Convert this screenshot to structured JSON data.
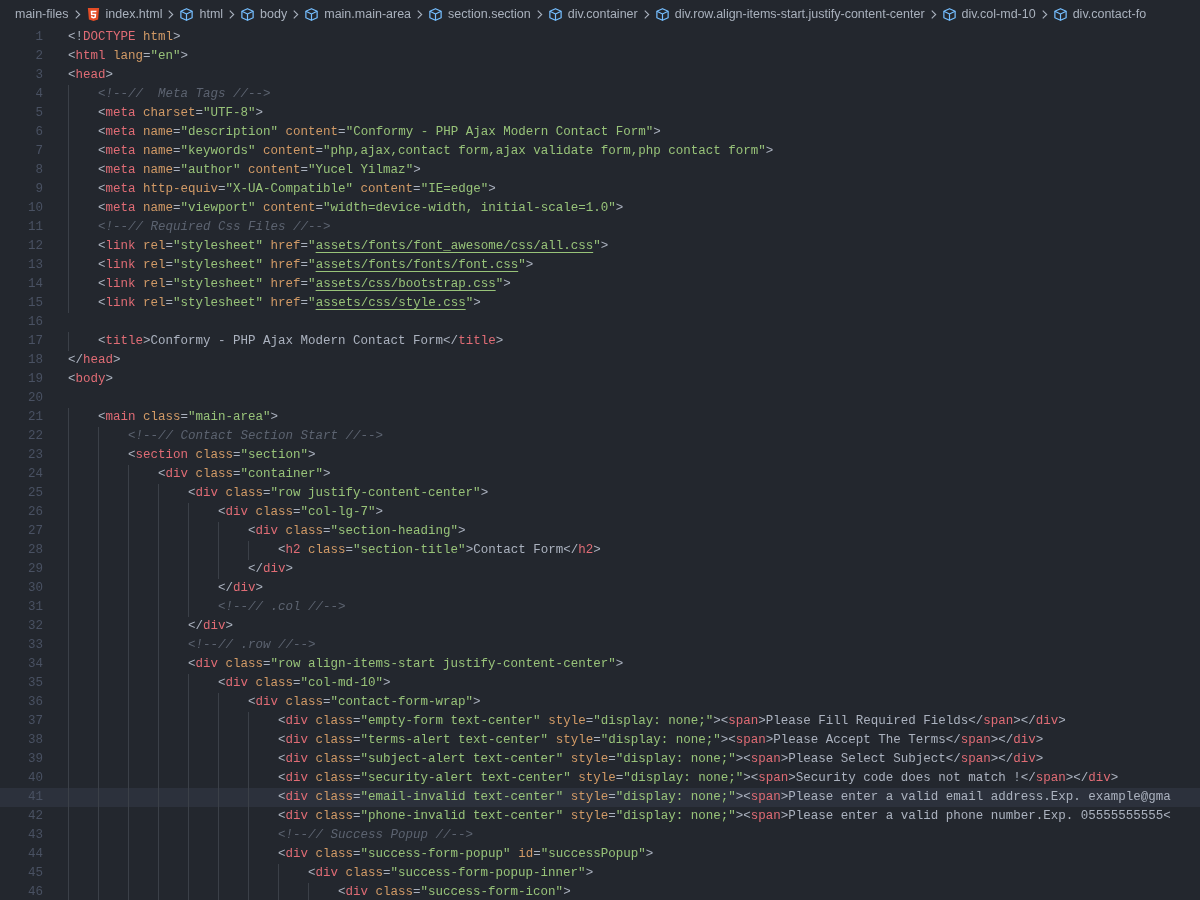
{
  "breadcrumbs": [
    {
      "kind": "folder",
      "label": "main-files"
    },
    {
      "kind": "html-file",
      "label": "index.html"
    },
    {
      "kind": "element",
      "label": "html"
    },
    {
      "kind": "element",
      "label": "body"
    },
    {
      "kind": "element",
      "label": "main.main-area"
    },
    {
      "kind": "element",
      "label": "section.section"
    },
    {
      "kind": "element",
      "label": "div.container"
    },
    {
      "kind": "element",
      "label": "div.row.align-items-start.justify-content-center"
    },
    {
      "kind": "element",
      "label": "div.col-md-10"
    },
    {
      "kind": "element",
      "label": "div.contact-fo"
    }
  ],
  "lines": [
    {
      "number": "1",
      "current": false,
      "tokens": [
        {
          "kind": "p",
          "text": "<!"
        },
        {
          "kind": "t",
          "text": "DOCTYPE"
        },
        {
          "kind": "a",
          "text": " html"
        },
        {
          "kind": "p",
          "text": ">"
        }
      ]
    },
    {
      "number": "2",
      "current": false,
      "tokens": [
        {
          "kind": "p",
          "text": "<"
        },
        {
          "kind": "t",
          "text": "html"
        },
        {
          "kind": "a",
          "text": " lang"
        },
        {
          "kind": "p",
          "text": "="
        },
        {
          "kind": "s",
          "text": "\"en\""
        },
        {
          "kind": "p",
          "text": ">"
        }
      ]
    },
    {
      "number": "3",
      "current": false,
      "tokens": [
        {
          "kind": "p",
          "text": "<"
        },
        {
          "kind": "t",
          "text": "head"
        },
        {
          "kind": "p",
          "text": ">"
        }
      ]
    },
    {
      "number": "4",
      "current": false,
      "tokens": [
        {
          "kind": "c",
          "text": "    <!--//  Meta Tags //-->"
        }
      ]
    },
    {
      "number": "5",
      "current": false,
      "tokens": [
        {
          "kind": "p",
          "text": "    <"
        },
        {
          "kind": "t",
          "text": "meta"
        },
        {
          "kind": "a",
          "text": " charset"
        },
        {
          "kind": "p",
          "text": "="
        },
        {
          "kind": "s",
          "text": "\"UTF-8\""
        },
        {
          "kind": "p",
          "text": ">"
        }
      ]
    },
    {
      "number": "6",
      "current": false,
      "tokens": [
        {
          "kind": "p",
          "text": "    <"
        },
        {
          "kind": "t",
          "text": "meta"
        },
        {
          "kind": "a",
          "text": " name"
        },
        {
          "kind": "p",
          "text": "="
        },
        {
          "kind": "s",
          "text": "\"description\""
        },
        {
          "kind": "a",
          "text": " content"
        },
        {
          "kind": "p",
          "text": "="
        },
        {
          "kind": "s",
          "text": "\"Conformy - PHP Ajax Modern Contact Form\""
        },
        {
          "kind": "p",
          "text": ">"
        }
      ]
    },
    {
      "number": "7",
      "current": false,
      "tokens": [
        {
          "kind": "p",
          "text": "    <"
        },
        {
          "kind": "t",
          "text": "meta"
        },
        {
          "kind": "a",
          "text": " name"
        },
        {
          "kind": "p",
          "text": "="
        },
        {
          "kind": "s",
          "text": "\"keywords\""
        },
        {
          "kind": "a",
          "text": " content"
        },
        {
          "kind": "p",
          "text": "="
        },
        {
          "kind": "s",
          "text": "\"php,ajax,contact form,ajax validate form,php contact form\""
        },
        {
          "kind": "p",
          "text": ">"
        }
      ]
    },
    {
      "number": "8",
      "current": false,
      "tokens": [
        {
          "kind": "p",
          "text": "    <"
        },
        {
          "kind": "t",
          "text": "meta"
        },
        {
          "kind": "a",
          "text": " name"
        },
        {
          "kind": "p",
          "text": "="
        },
        {
          "kind": "s",
          "text": "\"author\""
        },
        {
          "kind": "a",
          "text": " content"
        },
        {
          "kind": "p",
          "text": "="
        },
        {
          "kind": "s",
          "text": "\"Yucel Yilmaz\""
        },
        {
          "kind": "p",
          "text": ">"
        }
      ]
    },
    {
      "number": "9",
      "current": false,
      "tokens": [
        {
          "kind": "p",
          "text": "    <"
        },
        {
          "kind": "t",
          "text": "meta"
        },
        {
          "kind": "a",
          "text": " http-equiv"
        },
        {
          "kind": "p",
          "text": "="
        },
        {
          "kind": "s",
          "text": "\"X-UA-Compatible\""
        },
        {
          "kind": "a",
          "text": " content"
        },
        {
          "kind": "p",
          "text": "="
        },
        {
          "kind": "s",
          "text": "\"IE=edge\""
        },
        {
          "kind": "p",
          "text": ">"
        }
      ]
    },
    {
      "number": "10",
      "current": false,
      "tokens": [
        {
          "kind": "p",
          "text": "    <"
        },
        {
          "kind": "t",
          "text": "meta"
        },
        {
          "kind": "a",
          "text": " name"
        },
        {
          "kind": "p",
          "text": "="
        },
        {
          "kind": "s",
          "text": "\"viewport\""
        },
        {
          "kind": "a",
          "text": " content"
        },
        {
          "kind": "p",
          "text": "="
        },
        {
          "kind": "s",
          "text": "\"width=device-width, initial-scale=1.0\""
        },
        {
          "kind": "p",
          "text": ">"
        }
      ]
    },
    {
      "number": "11",
      "current": false,
      "tokens": [
        {
          "kind": "c",
          "text": "    <!--// Required Css Files //-->"
        }
      ]
    },
    {
      "number": "12",
      "current": false,
      "tokens": [
        {
          "kind": "p",
          "text": "    <"
        },
        {
          "kind": "t",
          "text": "link"
        },
        {
          "kind": "a",
          "text": " rel"
        },
        {
          "kind": "p",
          "text": "="
        },
        {
          "kind": "s",
          "text": "\"stylesheet\""
        },
        {
          "kind": "a",
          "text": " href"
        },
        {
          "kind": "p",
          "text": "="
        },
        {
          "kind": "s",
          "text": "\""
        },
        {
          "kind": "u",
          "text": "assets/fonts/font_awesome/css/all.css"
        },
        {
          "kind": "s",
          "text": "\""
        },
        {
          "kind": "p",
          "text": ">"
        }
      ]
    },
    {
      "number": "13",
      "current": false,
      "tokens": [
        {
          "kind": "p",
          "text": "    <"
        },
        {
          "kind": "t",
          "text": "link"
        },
        {
          "kind": "a",
          "text": " rel"
        },
        {
          "kind": "p",
          "text": "="
        },
        {
          "kind": "s",
          "text": "\"stylesheet\""
        },
        {
          "kind": "a",
          "text": " href"
        },
        {
          "kind": "p",
          "text": "="
        },
        {
          "kind": "s",
          "text": "\""
        },
        {
          "kind": "u",
          "text": "assets/fonts/fonts/font.css"
        },
        {
          "kind": "s",
          "text": "\""
        },
        {
          "kind": "p",
          "text": ">"
        }
      ]
    },
    {
      "number": "14",
      "current": false,
      "tokens": [
        {
          "kind": "p",
          "text": "    <"
        },
        {
          "kind": "t",
          "text": "link"
        },
        {
          "kind": "a",
          "text": " rel"
        },
        {
          "kind": "p",
          "text": "="
        },
        {
          "kind": "s",
          "text": "\"stylesheet\""
        },
        {
          "kind": "a",
          "text": " href"
        },
        {
          "kind": "p",
          "text": "="
        },
        {
          "kind": "s",
          "text": "\""
        },
        {
          "kind": "u",
          "text": "assets/css/bootstrap.css"
        },
        {
          "kind": "s",
          "text": "\""
        },
        {
          "kind": "p",
          "text": ">"
        }
      ]
    },
    {
      "number": "15",
      "current": false,
      "tokens": [
        {
          "kind": "p",
          "text": "    <"
        },
        {
          "kind": "t",
          "text": "link"
        },
        {
          "kind": "a",
          "text": " rel"
        },
        {
          "kind": "p",
          "text": "="
        },
        {
          "kind": "s",
          "text": "\"stylesheet\""
        },
        {
          "kind": "a",
          "text": " href"
        },
        {
          "kind": "p",
          "text": "="
        },
        {
          "kind": "s",
          "text": "\""
        },
        {
          "kind": "u",
          "text": "assets/css/style.css"
        },
        {
          "kind": "s",
          "text": "\""
        },
        {
          "kind": "p",
          "text": ">"
        }
      ]
    },
    {
      "number": "16",
      "current": false
    },
    {
      "number": "17",
      "current": false,
      "tokens": [
        {
          "kind": "p",
          "text": "    <"
        },
        {
          "kind": "t",
          "text": "title"
        },
        {
          "kind": "p",
          "text": ">"
        },
        {
          "kind": "x",
          "text": "Conformy - PHP Ajax Modern Contact Form"
        },
        {
          "kind": "p",
          "text": "</"
        },
        {
          "kind": "t",
          "text": "title"
        },
        {
          "kind": "p",
          "text": ">"
        }
      ]
    },
    {
      "number": "18",
      "current": false,
      "tokens": [
        {
          "kind": "p",
          "text": "</"
        },
        {
          "kind": "t",
          "text": "head"
        },
        {
          "kind": "p",
          "text": ">"
        }
      ]
    },
    {
      "number": "19",
      "current": false,
      "tokens": [
        {
          "kind": "p",
          "text": "<"
        },
        {
          "kind": "t",
          "text": "body"
        },
        {
          "kind": "p",
          "text": ">"
        }
      ]
    },
    {
      "number": "20",
      "current": false
    },
    {
      "number": "21",
      "current": false,
      "tokens": [
        {
          "kind": "p",
          "text": "    <"
        },
        {
          "kind": "t",
          "text": "main"
        },
        {
          "kind": "a",
          "text": " class"
        },
        {
          "kind": "p",
          "text": "="
        },
        {
          "kind": "s",
          "text": "\"main-area\""
        },
        {
          "kind": "p",
          "text": ">"
        }
      ]
    },
    {
      "number": "22",
      "current": false,
      "tokens": [
        {
          "kind": "c",
          "text": "        <!--// Contact Section Start //-->"
        }
      ]
    },
    {
      "number": "23",
      "current": false,
      "tokens": [
        {
          "kind": "p",
          "text": "        <"
        },
        {
          "kind": "t",
          "text": "section"
        },
        {
          "kind": "a",
          "text": " class"
        },
        {
          "kind": "p",
          "text": "="
        },
        {
          "kind": "s",
          "text": "\"section\""
        },
        {
          "kind": "p",
          "text": ">"
        }
      ]
    },
    {
      "number": "24",
      "current": false,
      "tokens": [
        {
          "kind": "p",
          "text": "            <"
        },
        {
          "kind": "t",
          "text": "div"
        },
        {
          "kind": "a",
          "text": " class"
        },
        {
          "kind": "p",
          "text": "="
        },
        {
          "kind": "s",
          "text": "\"container\""
        },
        {
          "kind": "p",
          "text": ">"
        }
      ]
    },
    {
      "number": "25",
      "current": false,
      "tokens": [
        {
          "kind": "p",
          "text": "                <"
        },
        {
          "kind": "t",
          "text": "div"
        },
        {
          "kind": "a",
          "text": " class"
        },
        {
          "kind": "p",
          "text": "="
        },
        {
          "kind": "s",
          "text": "\"row justify-content-center\""
        },
        {
          "kind": "p",
          "text": ">"
        }
      ]
    },
    {
      "number": "26",
      "current": false,
      "tokens": [
        {
          "kind": "p",
          "text": "                    <"
        },
        {
          "kind": "t",
          "text": "div"
        },
        {
          "kind": "a",
          "text": " class"
        },
        {
          "kind": "p",
          "text": "="
        },
        {
          "kind": "s",
          "text": "\"col-lg-7\""
        },
        {
          "kind": "p",
          "text": ">"
        }
      ]
    },
    {
      "number": "27",
      "current": false,
      "tokens": [
        {
          "kind": "p",
          "text": "                        <"
        },
        {
          "kind": "t",
          "text": "div"
        },
        {
          "kind": "a",
          "text": " class"
        },
        {
          "kind": "p",
          "text": "="
        },
        {
          "kind": "s",
          "text": "\"section-heading\""
        },
        {
          "kind": "p",
          "text": ">"
        }
      ]
    },
    {
      "number": "28",
      "current": false,
      "tokens": [
        {
          "kind": "p",
          "text": "                            <"
        },
        {
          "kind": "t",
          "text": "h2"
        },
        {
          "kind": "a",
          "text": " class"
        },
        {
          "kind": "p",
          "text": "="
        },
        {
          "kind": "s",
          "text": "\"section-title\""
        },
        {
          "kind": "p",
          "text": ">"
        },
        {
          "kind": "x",
          "text": "Contact Form"
        },
        {
          "kind": "p",
          "text": "</"
        },
        {
          "kind": "t",
          "text": "h2"
        },
        {
          "kind": "p",
          "text": ">"
        }
      ]
    },
    {
      "number": "29",
      "current": false,
      "tokens": [
        {
          "kind": "p",
          "text": "                        </"
        },
        {
          "kind": "t",
          "text": "div"
        },
        {
          "kind": "p",
          "text": ">"
        }
      ]
    },
    {
      "number": "30",
      "current": false,
      "tokens": [
        {
          "kind": "p",
          "text": "                    </"
        },
        {
          "kind": "t",
          "text": "div"
        },
        {
          "kind": "p",
          "text": ">"
        }
      ]
    },
    {
      "number": "31",
      "current": false,
      "tokens": [
        {
          "kind": "c",
          "text": "                    <!--// .col //-->"
        }
      ]
    },
    {
      "number": "32",
      "current": false,
      "tokens": [
        {
          "kind": "p",
          "text": "                </"
        },
        {
          "kind": "t",
          "text": "div"
        },
        {
          "kind": "p",
          "text": ">"
        }
      ]
    },
    {
      "number": "33",
      "current": false,
      "tokens": [
        {
          "kind": "c",
          "text": "                <!--// .row //-->"
        }
      ]
    },
    {
      "number": "34",
      "current": false,
      "tokens": [
        {
          "kind": "p",
          "text": "                <"
        },
        {
          "kind": "t",
          "text": "div"
        },
        {
          "kind": "a",
          "text": " class"
        },
        {
          "kind": "p",
          "text": "="
        },
        {
          "kind": "s",
          "text": "\"row align-items-start justify-content-center\""
        },
        {
          "kind": "p",
          "text": ">"
        }
      ]
    },
    {
      "number": "35",
      "current": false,
      "tokens": [
        {
          "kind": "p",
          "text": "                    <"
        },
        {
          "kind": "t",
          "text": "div"
        },
        {
          "kind": "a",
          "text": " class"
        },
        {
          "kind": "p",
          "text": "="
        },
        {
          "kind": "s",
          "text": "\"col-md-10\""
        },
        {
          "kind": "p",
          "text": ">"
        }
      ]
    },
    {
      "number": "36",
      "current": false,
      "tokens": [
        {
          "kind": "p",
          "text": "                        <"
        },
        {
          "kind": "t",
          "text": "div"
        },
        {
          "kind": "a",
          "text": " class"
        },
        {
          "kind": "p",
          "text": "="
        },
        {
          "kind": "s",
          "text": "\"contact-form-wrap\""
        },
        {
          "kind": "p",
          "text": ">"
        }
      ]
    },
    {
      "number": "37",
      "current": false,
      "tokens": [
        {
          "kind": "p",
          "text": "                            <"
        },
        {
          "kind": "t",
          "text": "div"
        },
        {
          "kind": "a",
          "text": " class"
        },
        {
          "kind": "p",
          "text": "="
        },
        {
          "kind": "s",
          "text": "\"empty-form text-center\""
        },
        {
          "kind": "a",
          "text": " style"
        },
        {
          "kind": "p",
          "text": "="
        },
        {
          "kind": "s",
          "text": "\"display: none;\""
        },
        {
          "kind": "p",
          "text": "><"
        },
        {
          "kind": "t",
          "text": "span"
        },
        {
          "kind": "p",
          "text": ">"
        },
        {
          "kind": "x",
          "text": "Please Fill Required Fields"
        },
        {
          "kind": "p",
          "text": "</"
        },
        {
          "kind": "t",
          "text": "span"
        },
        {
          "kind": "p",
          "text": "></"
        },
        {
          "kind": "t",
          "text": "div"
        },
        {
          "kind": "p",
          "text": ">"
        }
      ]
    },
    {
      "number": "38",
      "current": false,
      "tokens": [
        {
          "kind": "p",
          "text": "                            <"
        },
        {
          "kind": "t",
          "text": "div"
        },
        {
          "kind": "a",
          "text": " class"
        },
        {
          "kind": "p",
          "text": "="
        },
        {
          "kind": "s",
          "text": "\"terms-alert text-center\""
        },
        {
          "kind": "a",
          "text": " style"
        },
        {
          "kind": "p",
          "text": "="
        },
        {
          "kind": "s",
          "text": "\"display: none;\""
        },
        {
          "kind": "p",
          "text": "><"
        },
        {
          "kind": "t",
          "text": "span"
        },
        {
          "kind": "p",
          "text": ">"
        },
        {
          "kind": "x",
          "text": "Please Accept The Terms"
        },
        {
          "kind": "p",
          "text": "</"
        },
        {
          "kind": "t",
          "text": "span"
        },
        {
          "kind": "p",
          "text": "></"
        },
        {
          "kind": "t",
          "text": "div"
        },
        {
          "kind": "p",
          "text": ">"
        }
      ]
    },
    {
      "number": "39",
      "current": false,
      "tokens": [
        {
          "kind": "p",
          "text": "                            <"
        },
        {
          "kind": "t",
          "text": "div"
        },
        {
          "kind": "a",
          "text": " class"
        },
        {
          "kind": "p",
          "text": "="
        },
        {
          "kind": "s",
          "text": "\"subject-alert text-center\""
        },
        {
          "kind": "a",
          "text": " style"
        },
        {
          "kind": "p",
          "text": "="
        },
        {
          "kind": "s",
          "text": "\"display: none;\""
        },
        {
          "kind": "p",
          "text": "><"
        },
        {
          "kind": "t",
          "text": "span"
        },
        {
          "kind": "p",
          "text": ">"
        },
        {
          "kind": "x",
          "text": "Please Select Subject"
        },
        {
          "kind": "p",
          "text": "</"
        },
        {
          "kind": "t",
          "text": "span"
        },
        {
          "kind": "p",
          "text": "></"
        },
        {
          "kind": "t",
          "text": "div"
        },
        {
          "kind": "p",
          "text": ">"
        }
      ]
    },
    {
      "number": "40",
      "current": false,
      "tokens": [
        {
          "kind": "p",
          "text": "                            <"
        },
        {
          "kind": "t",
          "text": "div"
        },
        {
          "kind": "a",
          "text": " class"
        },
        {
          "kind": "p",
          "text": "="
        },
        {
          "kind": "s",
          "text": "\"security-alert text-center\""
        },
        {
          "kind": "a",
          "text": " style"
        },
        {
          "kind": "p",
          "text": "="
        },
        {
          "kind": "s",
          "text": "\"display: none;\""
        },
        {
          "kind": "p",
          "text": "><"
        },
        {
          "kind": "t",
          "text": "span"
        },
        {
          "kind": "p",
          "text": ">"
        },
        {
          "kind": "x",
          "text": "Security code does not match !"
        },
        {
          "kind": "p",
          "text": "</"
        },
        {
          "kind": "t",
          "text": "span"
        },
        {
          "kind": "p",
          "text": "></"
        },
        {
          "kind": "t",
          "text": "div"
        },
        {
          "kind": "p",
          "text": ">"
        }
      ]
    },
    {
      "number": "41",
      "current": true,
      "tokens": [
        {
          "kind": "p",
          "text": "                            <"
        },
        {
          "kind": "t",
          "text": "div"
        },
        {
          "kind": "a",
          "text": " class"
        },
        {
          "kind": "p",
          "text": "="
        },
        {
          "kind": "s",
          "text": "\"email-invalid text-center\""
        },
        {
          "kind": "a",
          "text": " style"
        },
        {
          "kind": "p",
          "text": "="
        },
        {
          "kind": "s",
          "text": "\"display: none;\""
        },
        {
          "kind": "p",
          "text": "><"
        },
        {
          "kind": "t",
          "text": "span"
        },
        {
          "kind": "p",
          "text": ">"
        },
        {
          "kind": "x",
          "text": "Please enter a valid email address.Exp. example@gma"
        }
      ]
    },
    {
      "number": "42",
      "current": false,
      "tokens": [
        {
          "kind": "p",
          "text": "                            <"
        },
        {
          "kind": "t",
          "text": "div"
        },
        {
          "kind": "a",
          "text": " class"
        },
        {
          "kind": "p",
          "text": "="
        },
        {
          "kind": "s",
          "text": "\"phone-invalid text-center\""
        },
        {
          "kind": "a",
          "text": " style"
        },
        {
          "kind": "p",
          "text": "="
        },
        {
          "kind": "s",
          "text": "\"display: none;\""
        },
        {
          "kind": "p",
          "text": "><"
        },
        {
          "kind": "t",
          "text": "span"
        },
        {
          "kind": "p",
          "text": ">"
        },
        {
          "kind": "x",
          "text": "Please enter a valid phone number.Exp. 05555555555<"
        }
      ]
    },
    {
      "number": "43",
      "current": false,
      "tokens": [
        {
          "kind": "c",
          "text": "                            <!--// Success Popup //-->"
        }
      ]
    },
    {
      "number": "44",
      "current": false,
      "tokens": [
        {
          "kind": "p",
          "text": "                            <"
        },
        {
          "kind": "t",
          "text": "div"
        },
        {
          "kind": "a",
          "text": " class"
        },
        {
          "kind": "p",
          "text": "="
        },
        {
          "kind": "s",
          "text": "\"success-form-popup\""
        },
        {
          "kind": "a",
          "text": " id"
        },
        {
          "kind": "p",
          "text": "="
        },
        {
          "kind": "s",
          "text": "\"successPopup\""
        },
        {
          "kind": "p",
          "text": ">"
        }
      ]
    },
    {
      "number": "45",
      "current": false,
      "tokens": [
        {
          "kind": "p",
          "text": "                                <"
        },
        {
          "kind": "t",
          "text": "div"
        },
        {
          "kind": "a",
          "text": " class"
        },
        {
          "kind": "p",
          "text": "="
        },
        {
          "kind": "s",
          "text": "\"success-form-popup-inner\""
        },
        {
          "kind": "p",
          "text": ">"
        }
      ]
    },
    {
      "number": "46",
      "current": false,
      "tokens": [
        {
          "kind": "p",
          "text": "                                    <"
        },
        {
          "kind": "t",
          "text": "div"
        },
        {
          "kind": "a",
          "text": " class"
        },
        {
          "kind": "p",
          "text": "="
        },
        {
          "kind": "s",
          "text": "\"success-form-icon\""
        },
        {
          "kind": "p",
          "text": ">"
        }
      ]
    }
  ]
}
